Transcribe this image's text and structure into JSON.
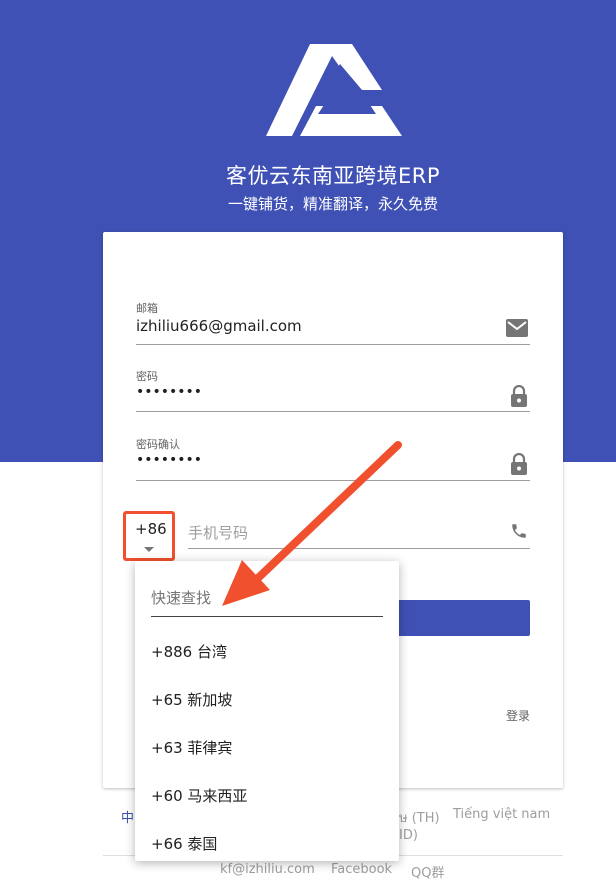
{
  "header": {
    "title": "客优云东南亚跨境ERP",
    "subtitle": "一键铺货，精准翻译，永久免费"
  },
  "form": {
    "email": {
      "label": "邮箱",
      "value": "izhiliu666@gmail.com",
      "icon": "mail-icon"
    },
    "password": {
      "label": "密码",
      "value": "••••••••",
      "icon": "lock-icon"
    },
    "password_confirm": {
      "label": "密码确认",
      "value": "••••••••",
      "icon": "lock-icon"
    },
    "country_code": "+86",
    "phone": {
      "placeholder": "手机号码",
      "icon": "phone-icon"
    },
    "login_link": "登录"
  },
  "dropdown": {
    "search_placeholder": "快速查找",
    "items": [
      "+886 台湾",
      "+65 新加坡",
      "+63 菲律宾",
      "+60 马来西亚",
      "+66 泰国"
    ]
  },
  "languages": {
    "partial_left": "中",
    "partial_th": "ษ (TH)",
    "partial_id": "ID)",
    "vietnamese": "Tiếng việt nam"
  },
  "footer": {
    "email": "kf@izhiliu.com",
    "facebook": "Facebook",
    "qq": "QQ群"
  },
  "colors": {
    "primary": "#3f51b5",
    "highlight": "#f0502e"
  }
}
